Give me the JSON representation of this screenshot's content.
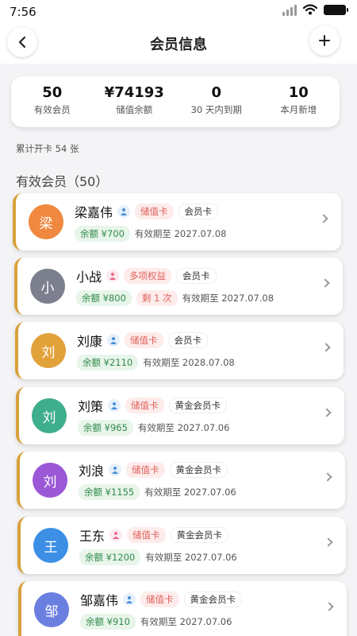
{
  "status_bar": {
    "time": "7:56"
  },
  "header": {
    "title": "会员信息"
  },
  "stats": [
    {
      "value": "50",
      "label": "有效会员"
    },
    {
      "value": "¥74193",
      "label": "储值余额"
    },
    {
      "value": "0",
      "label": "30 天内到期"
    },
    {
      "value": "10",
      "label": "本月新增"
    }
  ],
  "total_cards": "累计开卡 54 张",
  "section_title": "有效会员（50）",
  "members": [
    {
      "avatar": "梁",
      "avatar_color": "#f0883f",
      "name": "梁嘉伟",
      "gender_color": "#4a90d9",
      "type": "储值卡",
      "card": "会员卡",
      "balance": "余额 ¥700",
      "remain": "",
      "expire": "有效期至 2027.07.08"
    },
    {
      "avatar": "小",
      "avatar_color": "#7b7f8e",
      "name": "小战",
      "gender_color": "#e86a8a",
      "type": "多项权益",
      "card": "会员卡",
      "balance": "余额 ¥800",
      "remain": "剩 1 次",
      "expire": "有效期至 2027.07.08"
    },
    {
      "avatar": "刘",
      "avatar_color": "#e2a23a",
      "name": "刘康",
      "gender_color": "#4a90d9",
      "type": "储值卡",
      "card": "会员卡",
      "balance": "余额 ¥2110",
      "remain": "",
      "expire": "有效期至 2028.07.08"
    },
    {
      "avatar": "刘",
      "avatar_color": "#3fae8c",
      "name": "刘策",
      "gender_color": "#4a90d9",
      "type": "储值卡",
      "card": "黄金会员卡",
      "balance": "余额 ¥965",
      "remain": "",
      "expire": "有效期至 2027.07.06"
    },
    {
      "avatar": "刘",
      "avatar_color": "#9b58d6",
      "name": "刘浪",
      "gender_color": "#4a90d9",
      "type": "储值卡",
      "card": "黄金会员卡",
      "balance": "余额 ¥1155",
      "remain": "",
      "expire": "有效期至 2027.07.06"
    },
    {
      "avatar": "王",
      "avatar_color": "#3d8fe6",
      "name": "王东",
      "gender_color": "#e86a8a",
      "type": "储值卡",
      "card": "黄金会员卡",
      "balance": "余额 ¥1200",
      "remain": "",
      "expire": "有效期至 2027.07.06"
    },
    {
      "avatar": "邹",
      "avatar_color": "#6b7fe0",
      "name": "邹嘉伟",
      "gender_color": "#4a90d9",
      "type": "储值卡",
      "card": "黄金会员卡",
      "balance": "余额 ¥910",
      "remain": "",
      "expire": "有效期至 2027.07.06"
    }
  ]
}
